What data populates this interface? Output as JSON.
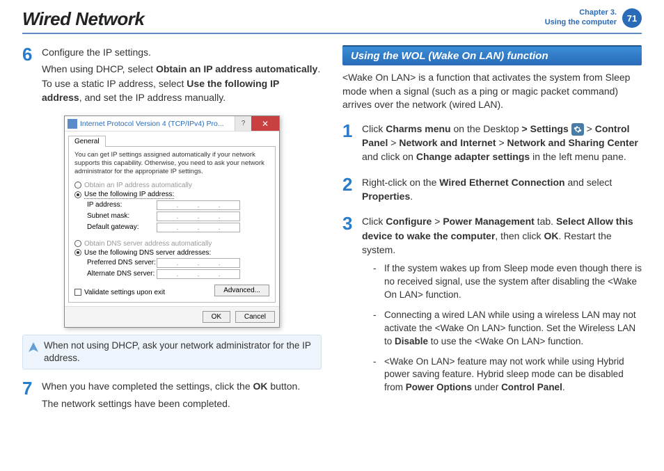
{
  "header": {
    "title": "Wired Network",
    "chapter_line1": "Chapter 3.",
    "chapter_line2": "Using the computer",
    "page_number": "71"
  },
  "left": {
    "step6": {
      "num": "6",
      "line1": "Configure the IP settings.",
      "line2a": "When using DHCP, select ",
      "line2b": "Obtain an IP address automatically",
      "line2c": ". To use a static IP address, select ",
      "line2d": "Use the following IP address",
      "line2e": ", and set the IP address manually."
    },
    "dialog": {
      "title": "Internet Protocol Version 4 (TCP/IPv4) Pro...",
      "help": "?",
      "close": "✕",
      "tab": "General",
      "description": "You can get IP settings assigned automatically if your network supports this capability. Otherwise, you need to ask your network administrator for the appropriate IP settings.",
      "radio_auto_ip": "Obtain an IP address automatically",
      "radio_use_ip": "Use the following IP address:",
      "ip_address_label": "IP address:",
      "subnet_label": "Subnet mask:",
      "gateway_label": "Default gateway:",
      "radio_auto_dns": "Obtain DNS server address automatically",
      "radio_use_dns": "Use the following DNS server addresses:",
      "preferred_dns_label": "Preferred DNS server:",
      "alt_dns_label": "Alternate DNS server:",
      "validate_label": "Validate settings upon exit",
      "advanced_btn": "Advanced...",
      "ok": "OK",
      "cancel": "Cancel"
    },
    "note": "When not using DHCP, ask your network administrator for the IP address.",
    "step7": {
      "num": "7",
      "line1a": "When you have completed the settings, click the ",
      "line1b": "OK",
      "line1c": " button.",
      "line2": "The network settings have been completed."
    }
  },
  "right": {
    "section_header": "Using the WOL (Wake On LAN) function",
    "intro": "<Wake On LAN> is a function that activates the system from Sleep mode when a signal (such as a ping or magic packet command) arrives over the network (wired LAN).",
    "step1": {
      "num": "1",
      "t1": "Click ",
      "t2": "Charms menu",
      "t3": " on the Desktop ",
      "t4": "> Settings",
      "t5": " > ",
      "t6": "Control Panel",
      "t7": " > ",
      "t8": "Network and Internet",
      "t9": " > ",
      "t10": "Network and Sharing Center",
      "t11": " and click on ",
      "t12": "Change adapter settings",
      "t13": " in the left menu pane."
    },
    "step2": {
      "num": "2",
      "t1": "Right-click on the ",
      "t2": "Wired Ethernet Connection",
      "t3": " and select ",
      "t4": "Properties",
      "t5": "."
    },
    "step3": {
      "num": "3",
      "t1": "Click ",
      "t2": "Configure",
      "t3": " > ",
      "t4": "Power Management",
      "t5": " tab. ",
      "t6": "Select Allow this device to wake the computer",
      "t7": ", then click ",
      "t8": "OK",
      "t9": ". Restart the system."
    },
    "bullets": {
      "b1": "If the system wakes up from Sleep mode even though there is no received signal, use the system after disabling the <Wake On LAN> function.",
      "b2a": "Connecting a wired LAN while using a wireless LAN may not activate the <Wake On LAN> function. Set the Wireless LAN to ",
      "b2b": "Disable",
      "b2c": " to use the <Wake On LAN> function.",
      "b3a": "<Wake On LAN> feature may not work while using Hybrid power saving feature. Hybrid sleep mode can be disabled from ",
      "b3b": "Power Options",
      "b3c": " under ",
      "b3d": "Control Panel",
      "b3e": "."
    }
  }
}
